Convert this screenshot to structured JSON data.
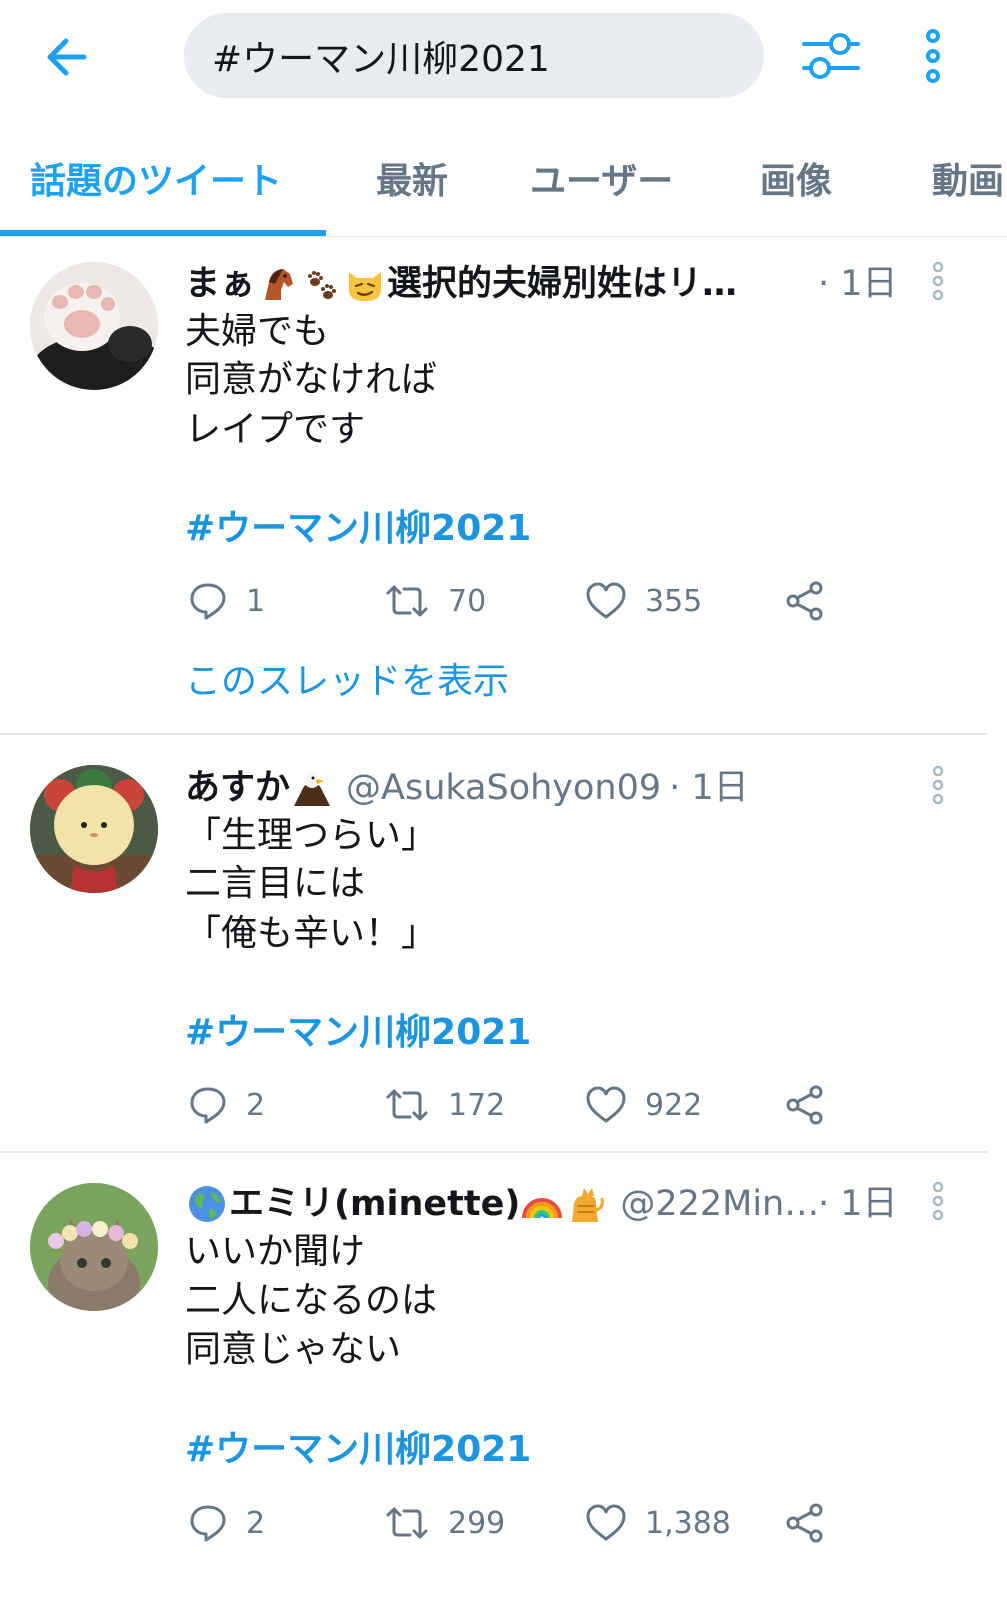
{
  "search": {
    "query": "#ウーマン川柳2021"
  },
  "tabs": [
    "話題のツイート",
    "最新",
    "ユーザー",
    "画像",
    "動画"
  ],
  "tweets": [
    {
      "name": "まぁ🐴🐾😼選択的夫婦別姓はリ…",
      "name_text": "まぁ",
      "name_suffix": "選択的夫婦別姓はリ…",
      "handle": "",
      "time": "· 1日",
      "lines": [
        "夫婦でも",
        "同意がなければ",
        "レイプです"
      ],
      "hashtag": "#ウーマン川柳2021",
      "replies": "1",
      "retweets": "70",
      "likes": "355",
      "thread_link": "このスレッドを表示"
    },
    {
      "name": "あすか🦅",
      "name_text": "あすか",
      "handle": "@AsukaSohyon09",
      "time": "· 1日",
      "lines": [
        "「生理つらい」",
        "二言目には",
        "「俺も辛い！」"
      ],
      "hashtag": "#ウーマン川柳2021",
      "replies": "2",
      "retweets": "172",
      "likes": "922"
    },
    {
      "name": "🌎エミリ(minette)🌈🐈",
      "name_text": "エミリ(minette)",
      "handle": "@222Min…",
      "time": "· 1日",
      "lines": [
        "いいか聞け",
        "二人になるのは",
        "同意じゃない"
      ],
      "hashtag": "#ウーマン川柳2021",
      "replies": "2",
      "retweets": "299",
      "likes": "1,388"
    }
  ]
}
